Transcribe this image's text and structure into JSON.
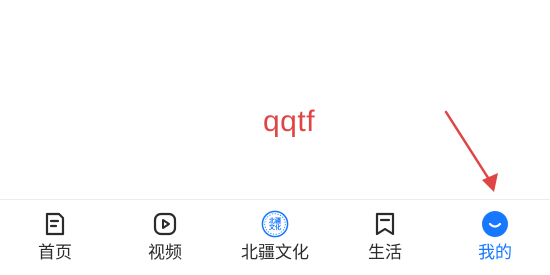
{
  "annotation": {
    "text": "qqtf",
    "color": "#e04545"
  },
  "tabbar": {
    "active_color": "#1677ff",
    "inactive_color": "#2b2b2b",
    "tabs": [
      {
        "label": "首页",
        "icon": "document-icon",
        "active": false
      },
      {
        "label": "视频",
        "icon": "video-play-icon",
        "active": false
      },
      {
        "label": "北疆文化",
        "icon": "beijiang-culture-logo-icon",
        "active": false,
        "logo_text": [
          "北疆",
          "文化"
        ]
      },
      {
        "label": "生活",
        "icon": "bookmark-icon",
        "active": false
      },
      {
        "label": "我的",
        "icon": "profile-smile-icon",
        "active": true
      }
    ]
  }
}
